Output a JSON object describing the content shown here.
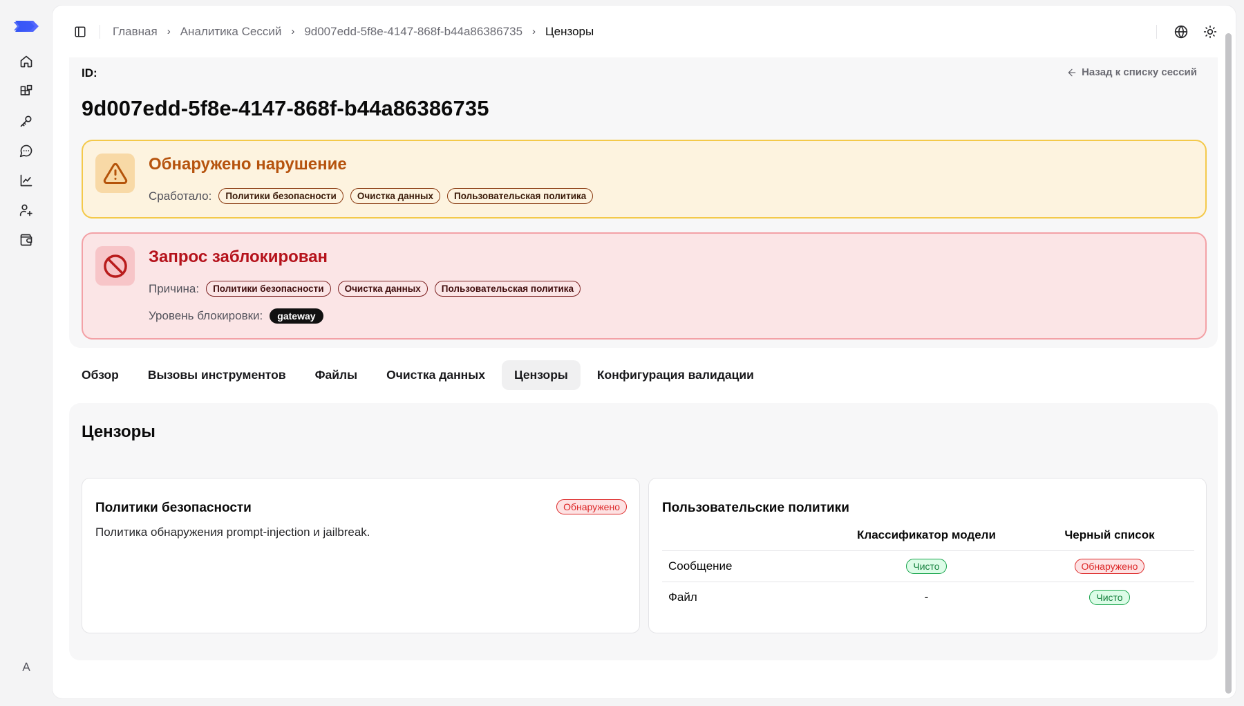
{
  "breadcrumb": {
    "items": [
      "Главная",
      "Аналитика Сессий",
      "9d007edd-5f8e-4147-868f-b44a86386735"
    ],
    "current": "Цензоры"
  },
  "session": {
    "id_label": "ID:",
    "id": "9d007edd-5f8e-4147-868f-b44a86386735",
    "back_label": "Назад к списку сессий"
  },
  "violation": {
    "title": "Обнаружено нарушение",
    "triggered_label": "Сработало:",
    "chips": [
      "Политики безопасности",
      "Очистка данных",
      "Пользовательская политика"
    ]
  },
  "blocked": {
    "title": "Запрос заблокирован",
    "reason_label": "Причина:",
    "chips": [
      "Политики безопасности",
      "Очистка данных",
      "Пользовательская политика"
    ],
    "level_label": "Уровень блокировки:",
    "level_value": "gateway"
  },
  "tabs": [
    "Обзор",
    "Вызовы инструментов",
    "Файлы",
    "Очистка данных",
    "Цензоры",
    "Конфигурация валидации"
  ],
  "active_tab": "Цензоры",
  "censors": {
    "title": "Цензоры",
    "security": {
      "title": "Политики безопасности",
      "status": "Обнаружено",
      "description": "Политика обнаружения prompt-injection и jailbreak."
    },
    "custom": {
      "title": "Пользовательские политики",
      "headers": [
        "",
        "Классификатор модели",
        "Черный список"
      ],
      "rows": [
        {
          "name": "Сообщение",
          "classifier": "Чисто",
          "blacklist": "Обнаружено"
        },
        {
          "name": "Файл",
          "classifier": "-",
          "blacklist": "Чисто"
        }
      ]
    }
  },
  "user": {
    "avatar_letter": "A"
  },
  "colors": {
    "brand": "#3b5bfd",
    "warning_bg": "#fdf3df",
    "warning_border": "#f4c94a",
    "danger_bg": "#fbe5e6",
    "danger_border": "#f3a1a6",
    "detected": "#dc2626",
    "clean": "#15803d"
  },
  "icons": {
    "sidebar": [
      "home-icon",
      "blocks-icon",
      "key-icon",
      "message-icon",
      "chart-line-icon",
      "user-plus-icon",
      "wallet-icon"
    ],
    "topbar": [
      "sidebar-toggle-icon",
      "globe-icon",
      "sun-icon"
    ]
  }
}
